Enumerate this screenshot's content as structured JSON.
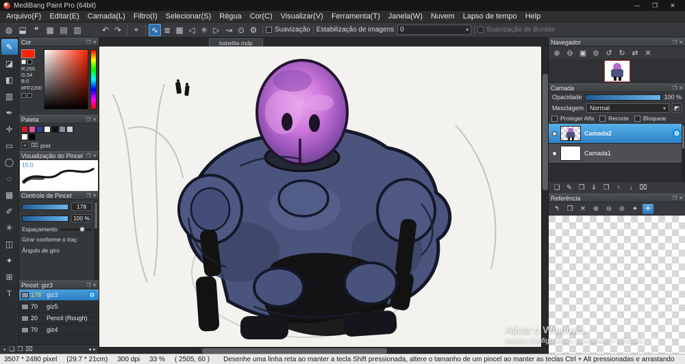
{
  "window": {
    "title": "MediBang Paint Pro (64bit)",
    "min": "—",
    "max": "❐",
    "close": "✕"
  },
  "menu": {
    "items": [
      "Arquivo(F)",
      "Editar(E)",
      "Camada(L)",
      "Filtro(I)",
      "Selecionar(S)",
      "Régua",
      "Cor(C)",
      "Visualizar(V)",
      "Ferramenta(T)",
      "Janela(W)",
      "Nuvem",
      "Lapso de tempo",
      "Help"
    ]
  },
  "quickbar": {
    "icons": [
      {
        "name": "cloud-icon",
        "glyph": "◍"
      },
      {
        "name": "save-icon",
        "glyph": "⬓"
      },
      {
        "name": "comment-icon",
        "glyph": "❝"
      },
      {
        "name": "material-grid-icon",
        "glyph": "▦"
      },
      {
        "name": "layout-rows-icon",
        "glyph": "▤"
      },
      {
        "name": "layout-cols-icon",
        "glyph": "▥"
      }
    ]
  },
  "toolbar": {
    "undo": "↶",
    "redo": "↷",
    "crosshair": "⌖",
    "stroke": "∿",
    "hatch": "≣",
    "grid": "▦",
    "snap_off": "◁",
    "snap_radial": "✳",
    "snap_parallel": "▷",
    "snap_curve": "↝",
    "snap_circle": "⊙",
    "gear": "⚙",
    "suavizacao_label": "Suavização",
    "suavizacao_checked": false,
    "estabilizacao_label": "Estabilização de imagens",
    "estabilizacao_value": "0",
    "dropdown_arrow": "▾",
    "bordas_label": "Suavização de Bordas",
    "bordas_checked": false
  },
  "tools": [
    {
      "name": "brush",
      "glyph": "✎",
      "selected": true
    },
    {
      "name": "eraser",
      "glyph": "◪"
    },
    {
      "name": "bucket",
      "glyph": "◧"
    },
    {
      "name": "gradient",
      "glyph": "▥"
    },
    {
      "name": "pen",
      "glyph": "✒"
    },
    {
      "name": "move",
      "glyph": "✛"
    },
    {
      "name": "rect-select",
      "glyph": "▭"
    },
    {
      "name": "ellipse-select",
      "glyph": "◯"
    },
    {
      "name": "lasso",
      "glyph": "◌"
    },
    {
      "name": "screentone",
      "glyph": "▦"
    },
    {
      "name": "select-pen",
      "glyph": "✐"
    },
    {
      "name": "magic-wand",
      "glyph": "✳"
    },
    {
      "name": "divide",
      "glyph": "◫"
    },
    {
      "name": "eyedropper",
      "glyph": "✦"
    },
    {
      "name": "grid",
      "glyph": "⊞"
    },
    {
      "name": "text",
      "glyph": "T"
    }
  ],
  "panel_header": {
    "float": "❐",
    "close": "✕"
  },
  "cor": {
    "title": "Cor",
    "r": "R:255",
    "g": "G:34",
    "b": "B:0",
    "hex": "#FF2200",
    "current": "#FF2200"
  },
  "paleta": {
    "title": "Paleta",
    "row1": [
      "#d51c28",
      "#e0559f",
      "#2a3f9b",
      "#f2f2f2",
      "#111111",
      "#87909a",
      "#c8ccd0"
    ],
    "row2": [
      "#ffffff",
      "#000000"
    ],
    "add": "+",
    "delete": "⌧",
    "name": "pret"
  },
  "preview": {
    "title": "Visualização do Pincel",
    "size": "15.0"
  },
  "controle": {
    "title": "Controle de Pincel",
    "size_value": "178",
    "opacity_value": "100 %",
    "espacamento": "Espaçamento",
    "girar": "Girar conforme o traç",
    "angulo": "Ângulo de giro"
  },
  "pincel": {
    "title": "Pincel: giz3",
    "gear": "⚙",
    "brushes": [
      {
        "size": "178",
        "name": "giz3",
        "selected": true
      },
      {
        "size": "70",
        "name": "giz5"
      },
      {
        "size": "20",
        "name": "Pencil (Rough)"
      },
      {
        "size": "70",
        "name": "giz4"
      }
    ]
  },
  "leftfooter": {
    "icons": [
      {
        "name": "add-brush-icon",
        "glyph": "+"
      },
      {
        "name": "new-brush-icon",
        "glyph": "❏"
      },
      {
        "name": "brush-folder-icon",
        "glyph": "❒"
      },
      {
        "name": "delete-brush-icon",
        "glyph": "⌧"
      }
    ],
    "arrows": [
      {
        "name": "scroll-left-icon",
        "glyph": "◂"
      },
      {
        "name": "scroll-right-icon",
        "glyph": "▸"
      }
    ]
  },
  "canvas": {
    "tab": "babelite.mdp"
  },
  "navegador": {
    "title": "Navegador",
    "icons": [
      {
        "name": "zoom-in-icon",
        "glyph": "⊕"
      },
      {
        "name": "zoom-out-icon",
        "glyph": "⊖"
      },
      {
        "name": "fit-window-icon",
        "glyph": "▣"
      },
      {
        "name": "zoom-100-icon",
        "glyph": "⊜"
      },
      {
        "name": "rotate-ccw-icon",
        "glyph": "↺"
      },
      {
        "name": "rotate-cw-icon",
        "glyph": "↻"
      },
      {
        "name": "flip-horizontal-icon",
        "glyph": "⇄"
      },
      {
        "name": "reset-view-icon",
        "glyph": "✕"
      }
    ]
  },
  "camada": {
    "title": "Camada",
    "opacidade_label": "Opacidade",
    "opacidade_value": "100 %",
    "mesclagem_label": "Mesclagem",
    "blend_value": "Normal",
    "dropdown_arrow": "▾",
    "blend_extra": "◩",
    "chk_alfa": "Proteger Alfa",
    "chk_recorte": "Recorte",
    "chk_bloquear": "Bloquear",
    "layers": [
      {
        "name": "Camada2",
        "selected": true,
        "gear": "⚙"
      },
      {
        "name": "Camada1",
        "selected": false
      }
    ],
    "footer": [
      {
        "name": "new-layer-icon",
        "glyph": "❏"
      },
      {
        "name": "new-layer-settings-icon",
        "glyph": "✎"
      },
      {
        "name": "duplicate-layer-icon",
        "glyph": "❐"
      },
      {
        "name": "merge-down-icon",
        "glyph": "⇓"
      },
      {
        "name": "new-folder-icon",
        "glyph": "❒"
      },
      {
        "name": "move-layer-up-icon",
        "glyph": "↑"
      },
      {
        "name": "move-layer-down-icon",
        "glyph": "↓"
      },
      {
        "name": "delete-layer-icon",
        "glyph": "⌧"
      }
    ]
  },
  "referencia": {
    "title": "Referência",
    "icons": [
      {
        "name": "back-icon",
        "glyph": "↰"
      },
      {
        "name": "open-folder-icon",
        "glyph": "❒"
      },
      {
        "name": "close-ref-icon",
        "glyph": "✕"
      },
      {
        "name": "ref-zoom-in-icon",
        "glyph": "⊕"
      },
      {
        "name": "ref-zoom-out-icon",
        "glyph": "⊖"
      },
      {
        "name": "ref-zoom-reset-icon",
        "glyph": "⊜"
      },
      {
        "name": "ref-eyedropper-icon",
        "glyph": "✦"
      },
      {
        "name": "ref-pan-icon",
        "glyph": "✛",
        "selected": true
      }
    ]
  },
  "watermark": {
    "line1": "Ativar o Windows",
    "line2": "Acesse Configurações para ativar o Windows."
  },
  "status": {
    "dims": "3507 * 2480 pixel",
    "cm": "(29.7 * 21cm)",
    "dpi": "300 dpi",
    "zoom": "33 %",
    "pos": "( 2505, 60 )",
    "hint": "Desenhe uma linha reta ao manter a tecla Shift pressionada, altere o tamanho de um pincel ao manter as teclas Ctrl + Alt pressionadas e arrastando"
  },
  "colors": {
    "accent": "#2f84c6",
    "selected_layer": "#3f9ad2",
    "current_color": "#FF2200"
  }
}
